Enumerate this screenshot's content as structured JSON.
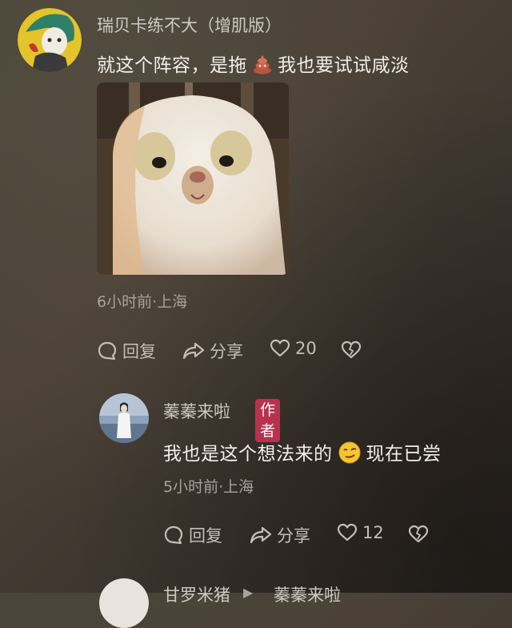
{
  "comments": [
    {
      "username": "瑞贝卡练不大（增肌版）",
      "text_before_emoji": "就这个阵容，是拖",
      "emoji": "poop-emoji",
      "text_after_emoji": "我也要试试咸淡",
      "meta": "6小时前·上海",
      "reply_label": "回复",
      "share_label": "分享",
      "like_count": "20"
    },
    {
      "username": "蓁蓁来啦",
      "badge": "作者",
      "text_before_emoji": "我也是这个想法来的",
      "emoji": "smirk-emoji",
      "text_after_emoji": "现在已尝",
      "meta": "5小时前·上海",
      "reply_label": "回复",
      "share_label": "分享",
      "like_count": "12"
    }
  ],
  "partial_next": {
    "username": "甘罗米猪",
    "reply_to": "蓁蓁来啦"
  },
  "colors": {
    "badge": "#b9324d",
    "background": "#443c33"
  }
}
